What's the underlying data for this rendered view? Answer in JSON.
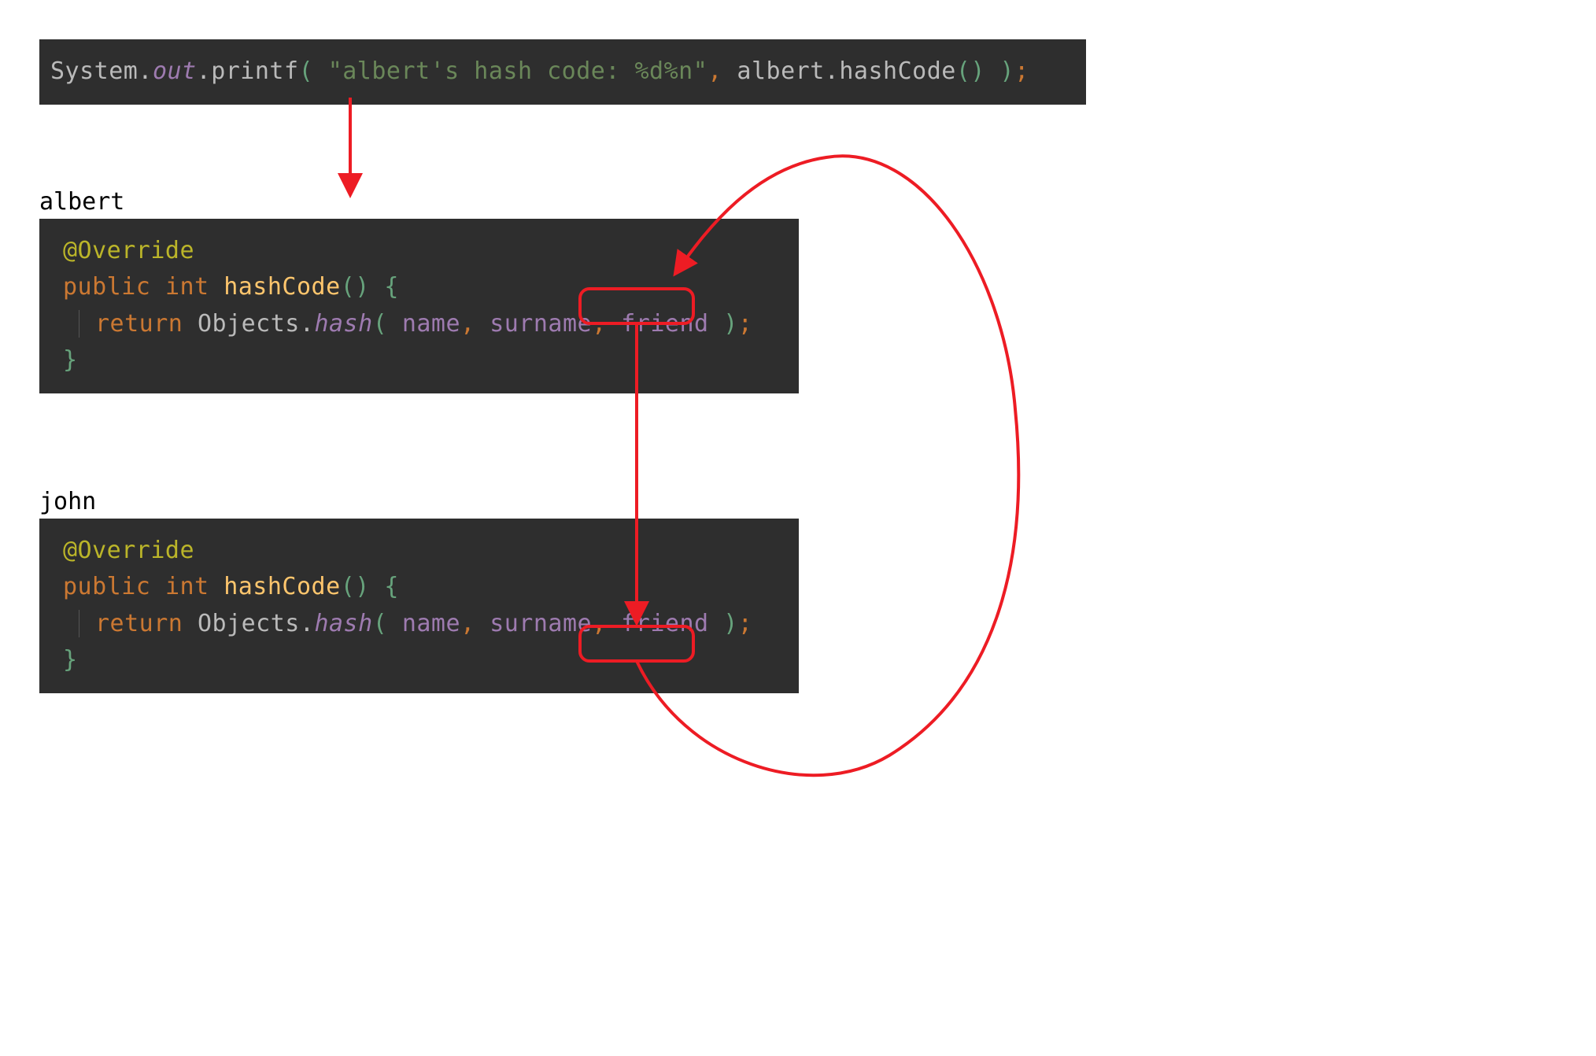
{
  "top_block": {
    "tokens": {
      "System": "System",
      "dot1": ".",
      "out": "out",
      "dot2": ".",
      "printf": "printf",
      "lparen": "(",
      "space1": " ",
      "string": "\"albert's hash code: %d%n\"",
      "comma": ",",
      "space2": " ",
      "albert": "albert",
      "dot3": ".",
      "hashCode": "hashCode",
      "call_lparen": "(",
      "call_rparen": ")",
      "space3": " ",
      "rparen": ")",
      "semi": ";"
    }
  },
  "labels": {
    "albert": "albert",
    "john": "john"
  },
  "method_block": {
    "annotation": "@Override",
    "public": "public",
    "int": "int",
    "hashCode": "hashCode",
    "lparen": "(",
    "rparen": ")",
    "space_ph": " ",
    "lbrace": "{",
    "return": "return",
    "Objects": "Objects",
    "dot": ".",
    "hash": "hash",
    "call_lparen": "(",
    "space1": " ",
    "name": "name",
    "comma1": ",",
    "surname": "surname",
    "comma2": ",",
    "friend": "friend",
    "space2": " ",
    "call_rparen": ")",
    "semi": ";",
    "rbrace": "}"
  },
  "annotation_color": "#ed1c24"
}
